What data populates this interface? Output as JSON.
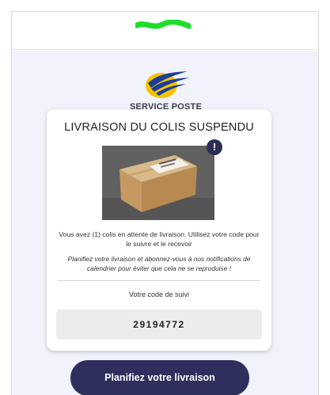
{
  "brand": {
    "name": "SERVICE POSTE"
  },
  "card": {
    "title": "LIVRAISON DU COLIS SUSPENDU",
    "message": "Vous avez (1) colis en attente de livraison. Utilisez votre code pour le suivre et le recevoir",
    "note": "Planifiez votre livraison et abonnez-vous à nos notifications de calendrier pour éviter que cela ne se reproduise !",
    "code_label": "Votre code de suivi",
    "tracking_code": "29194772",
    "alert_symbol": "!"
  },
  "cta": {
    "label": "Planifiez votre livraison"
  },
  "colors": {
    "page_background": "#f1f2fb",
    "accent_dark": "#2f2f5e",
    "logo_yellow": "#f6c400",
    "logo_blue": "#1b3f97",
    "scribble_green": "#1ddf2a"
  },
  "icons": {
    "alert": "exclamation-circle-icon",
    "logo": "service-poste-logo"
  }
}
